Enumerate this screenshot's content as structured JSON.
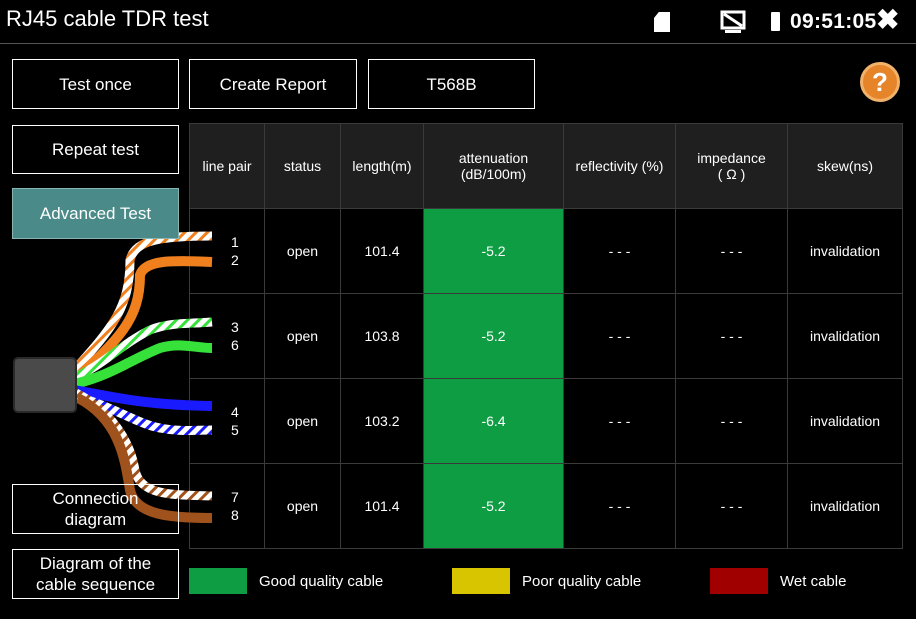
{
  "window": {
    "title": "RJ45 cable TDR test",
    "clock": "09:51:05"
  },
  "icons": {
    "sd": "sd-card-icon",
    "screen": "screen-off-icon",
    "battery": "battery-icon",
    "close": "close-icon",
    "help": "help-book-icon"
  },
  "toolbar": {
    "test_once": "Test once",
    "create_report": "Create Report",
    "standard": "T568B",
    "repeat_test": "Repeat test",
    "advanced_test": "Advanced Test",
    "connection_diagram_line1": "Connection",
    "connection_diagram_line2": "diagram",
    "sequence_line1": "Diagram of the",
    "sequence_line2": "cable sequence"
  },
  "table": {
    "headers": {
      "line_pair": "line pair",
      "status": "status",
      "length": "length(m)",
      "attenuation_line1": "attenuation",
      "attenuation_line2": "(dB/100m)",
      "reflectivity": "reflectivity (%)",
      "impedance_line1": "impedance",
      "impedance_line2": "( Ω )",
      "skew": "skew(ns)"
    },
    "rows": [
      {
        "pin_a": "1",
        "pin_b": "2",
        "status": "open",
        "length": "101.4",
        "attenuation": "-5.2",
        "reflectivity": "- - -",
        "impedance": "- - -",
        "skew": "invalidation"
      },
      {
        "pin_a": "3",
        "pin_b": "6",
        "status": "open",
        "length": "103.8",
        "attenuation": "-5.2",
        "reflectivity": "- - -",
        "impedance": "- - -",
        "skew": "invalidation"
      },
      {
        "pin_a": "4",
        "pin_b": "5",
        "status": "open",
        "length": "103.2",
        "attenuation": "-6.4",
        "reflectivity": "- - -",
        "impedance": "- - -",
        "skew": "invalidation"
      },
      {
        "pin_a": "7",
        "pin_b": "8",
        "status": "open",
        "length": "101.4",
        "attenuation": "-5.2",
        "reflectivity": "- - -",
        "impedance": "- - -",
        "skew": "invalidation"
      }
    ]
  },
  "legend": {
    "good": {
      "label": "Good quality cable",
      "color": "#0f9d43"
    },
    "poor": {
      "label": "Poor quality cable",
      "color": "#d9c400"
    },
    "wet": {
      "label": "Wet cable",
      "color": "#a00000"
    }
  },
  "colors": {
    "attenuation_good": "#0f9d43",
    "advanced_button": "#4a8a88",
    "wire_orange": "#f07f1d",
    "wire_green": "#36e23a",
    "wire_blue": "#1a1aff",
    "wire_brown": "#a0521d"
  }
}
